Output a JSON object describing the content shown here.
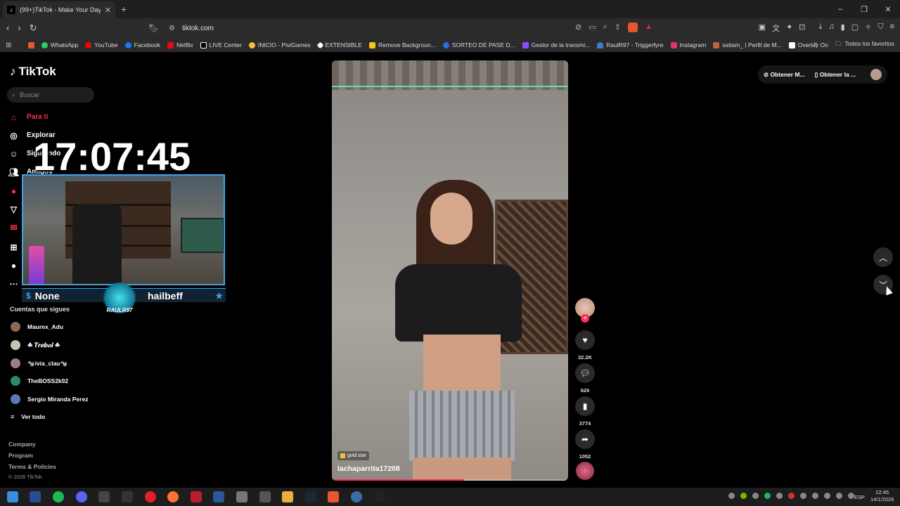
{
  "browser": {
    "tab_title": "(99+)TikTok - Make Your Day",
    "tab_close": "✕",
    "new_tab": "+",
    "url": "tiktok.com",
    "window_controls": [
      "–",
      "❐",
      "✕"
    ],
    "bookmarks": [
      {
        "label": "WhatsApp",
        "color": "#25d366"
      },
      {
        "label": "YouTube",
        "color": "#ff0000"
      },
      {
        "label": "Facebook",
        "color": "#1877f2"
      },
      {
        "label": "Netflix",
        "color": "#e50914"
      },
      {
        "label": "LIVE Center",
        "color": "#000000"
      },
      {
        "label": "INICIO - PiviGames",
        "color": "#f2c23a"
      },
      {
        "label": "EXTENSIBLE",
        "color": "#ffffff"
      },
      {
        "label": "Remove Backgroun...",
        "color": "#f5c518"
      },
      {
        "label": "SORTEO DE PASE D...",
        "color": "#2d6cdf"
      },
      {
        "label": "Gestor de la transmi...",
        "color": "#9146ff"
      },
      {
        "label": "RaulR97 - Triggerfyre",
        "color": "#3a7bd5"
      },
      {
        "label": "Instagram",
        "color": "#e1306c"
      },
      {
        "label": "satiam_ | Perfil de M...",
        "color": "#c4623a"
      },
      {
        "label": "Overlay On",
        "color": "#ffffff"
      }
    ],
    "bookmarks_more": "»",
    "all_favorites": "Todos los favoritos"
  },
  "sidebar": {
    "logo": "TikTok",
    "search_placeholder": "Buscar",
    "items": [
      {
        "label": "Para ti",
        "icon": "home-icon",
        "active": true
      },
      {
        "label": "Explorar",
        "icon": "compass-icon"
      },
      {
        "label": "Siguiendo",
        "icon": "following-icon"
      },
      {
        "label": "Amigos",
        "icon": "friends-icon"
      }
    ],
    "following_title": "Cuentas que sigues",
    "following": [
      {
        "name": "Maurex_Adu"
      },
      {
        "name": "☘ 𝑻𝒓𝒆𝒃𝒐𝒍 ☘"
      },
      {
        "name": "🐄ivia_clau🐄"
      },
      {
        "name": "TheBOSS2k02"
      },
      {
        "name": "Sergio Miranda Perez"
      }
    ],
    "see_all": "Ver todo",
    "footer_links": [
      "Company",
      "Program",
      "Terms & Policies"
    ],
    "copyright": "© 2026 TikTok"
  },
  "overlay": {
    "clock": "17:07:45",
    "cam_name": "None",
    "cam_handle": "hailbeff",
    "logo_text": "RAULR97"
  },
  "video": {
    "badge": "gold star",
    "username": "lachaparrita17208",
    "progress": 0.56
  },
  "actions": {
    "likes": "32.2K",
    "comments": "626",
    "saves": "3774",
    "shares": "1052"
  },
  "topright": {
    "get_app": "Obtener M...",
    "get_desktop": "Obtener la ..."
  },
  "taskbar": {
    "lang": "ESP",
    "time": "22:45",
    "date": "14/1/2026"
  },
  "colors": {
    "accent": "#fe2c55",
    "cam_border": "#3aa6e6"
  }
}
